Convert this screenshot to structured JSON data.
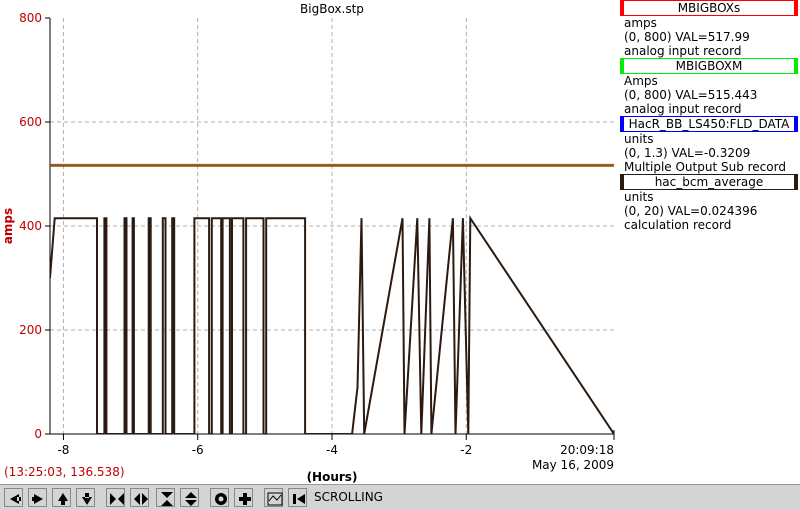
{
  "chart_data": {
    "type": "line",
    "title": "BigBox.stp",
    "ylabel": "amps",
    "xlabel": "(Hours)",
    "ylim": [
      0,
      800
    ],
    "xlim": [
      -8.2,
      0.2
    ],
    "grid": true,
    "y_ticks": [
      0,
      200,
      400,
      600,
      800
    ],
    "x_ticks": [
      -8,
      -6,
      -4,
      -2
    ],
    "y_tick_labels": [
      "0",
      "200",
      "400",
      "600",
      "800"
    ],
    "x_tick_labels": [
      "-8",
      "-6",
      "-4",
      "-2"
    ],
    "end_time": "20:09:18",
    "end_date": "May 16, 2009",
    "series": [
      {
        "name": "MBIGBOXs",
        "color": "#ff0000",
        "x": [
          -8.2,
          0.2
        ],
        "y": [
          517.99,
          517.99
        ]
      },
      {
        "name": "MBIGBOXM",
        "color": "#00cc00",
        "x": [
          -8.2,
          0.2
        ],
        "y": [
          515.443,
          515.443
        ]
      },
      {
        "name": "hac_bcm_average",
        "color": "#2a1a10",
        "x": [
          -8.2,
          -8.13,
          -8.12,
          -7.5,
          -7.5,
          -7.39,
          -7.39,
          -7.36,
          -7.36,
          -7.09,
          -7.09,
          -7.06,
          -7.06,
          -6.97,
          -6.97,
          -6.95,
          -6.95,
          -6.73,
          -6.73,
          -6.7,
          -6.7,
          -6.52,
          -6.52,
          -6.48,
          -6.48,
          -6.38,
          -6.38,
          -6.35,
          -6.35,
          -6.05,
          -6.05,
          -5.83,
          -5.83,
          -5.79,
          -5.79,
          -5.65,
          -5.65,
          -5.63,
          -5.63,
          -5.52,
          -5.52,
          -5.49,
          -5.49,
          -5.32,
          -5.32,
          -5.28,
          -5.28,
          -5.02,
          -5.02,
          -4.98,
          -4.98,
          -4.4,
          -4.4,
          -3.7,
          -3.62,
          -3.62,
          -3.56,
          -3.56,
          -3.52,
          -3.52,
          -2.95,
          -2.95,
          -2.92,
          -2.92,
          -2.73,
          -2.73,
          -2.67,
          -2.67,
          -2.55,
          -2.55,
          -2.52,
          -2.52,
          -2.2,
          -2.2,
          -2.16,
          -2.16,
          -2.05,
          -2.05,
          -1.97,
          -1.97,
          -1.94,
          -1.94,
          0.2
        ],
        "y": [
          300,
          415,
          415,
          415,
          0,
          0,
          415,
          415,
          0,
          0,
          415,
          415,
          0,
          0,
          415,
          415,
          0,
          0,
          415,
          415,
          0,
          0,
          415,
          415,
          0,
          0,
          415,
          415,
          0,
          0,
          415,
          415,
          0,
          0,
          415,
          415,
          0,
          0,
          415,
          415,
          0,
          0,
          415,
          415,
          0,
          0,
          415,
          415,
          0,
          0,
          415,
          415,
          0,
          0,
          90,
          90,
          415,
          415,
          0,
          0,
          415,
          415,
          0,
          0,
          415,
          415,
          0,
          0,
          415,
          415,
          0,
          0,
          415,
          415,
          0,
          0,
          415,
          415,
          0,
          0,
          415,
          415,
          0
        ]
      }
    ]
  },
  "pens": [
    {
      "name": "MBIGBOXs",
      "color": "#ff0000",
      "units": "amps",
      "range": "(0, 800)",
      "val": "VAL=517.99",
      "rtype": "analog input record"
    },
    {
      "name": "MBIGBOXM",
      "color": "#00ee00",
      "units": "Amps",
      "range": "(0, 800)",
      "val": "VAL=515.443",
      "rtype": "analog input record"
    },
    {
      "name": "HacR_BB_LS450:FLD_DATA",
      "color": "#0000ff",
      "units": "units",
      "range": "(0, 1.3)",
      "val": "VAL=-0.3209",
      "rtype": "Multiple Output Sub record"
    },
    {
      "name": "hac_bcm_average",
      "color": "#2a1a10",
      "units": "units",
      "range": "(0, 20)",
      "val": "VAL=0.024396",
      "rtype": "calculation record"
    }
  ],
  "cursor_readout": "(13:25:03, 136.538)",
  "toolbar": {
    "buttons": [
      "scroll-left-icon",
      "scroll-right-icon",
      "scroll-up-icon",
      "scroll-down-icon",
      "zoom-in-x-icon",
      "zoom-out-x-icon",
      "zoom-in-y-icon",
      "zoom-out-y-icon",
      "auto-scale-icon",
      "add-pen-icon",
      "toggle-grid-icon",
      "stop-scroll-icon"
    ],
    "mode_label": "SCROLLING"
  }
}
